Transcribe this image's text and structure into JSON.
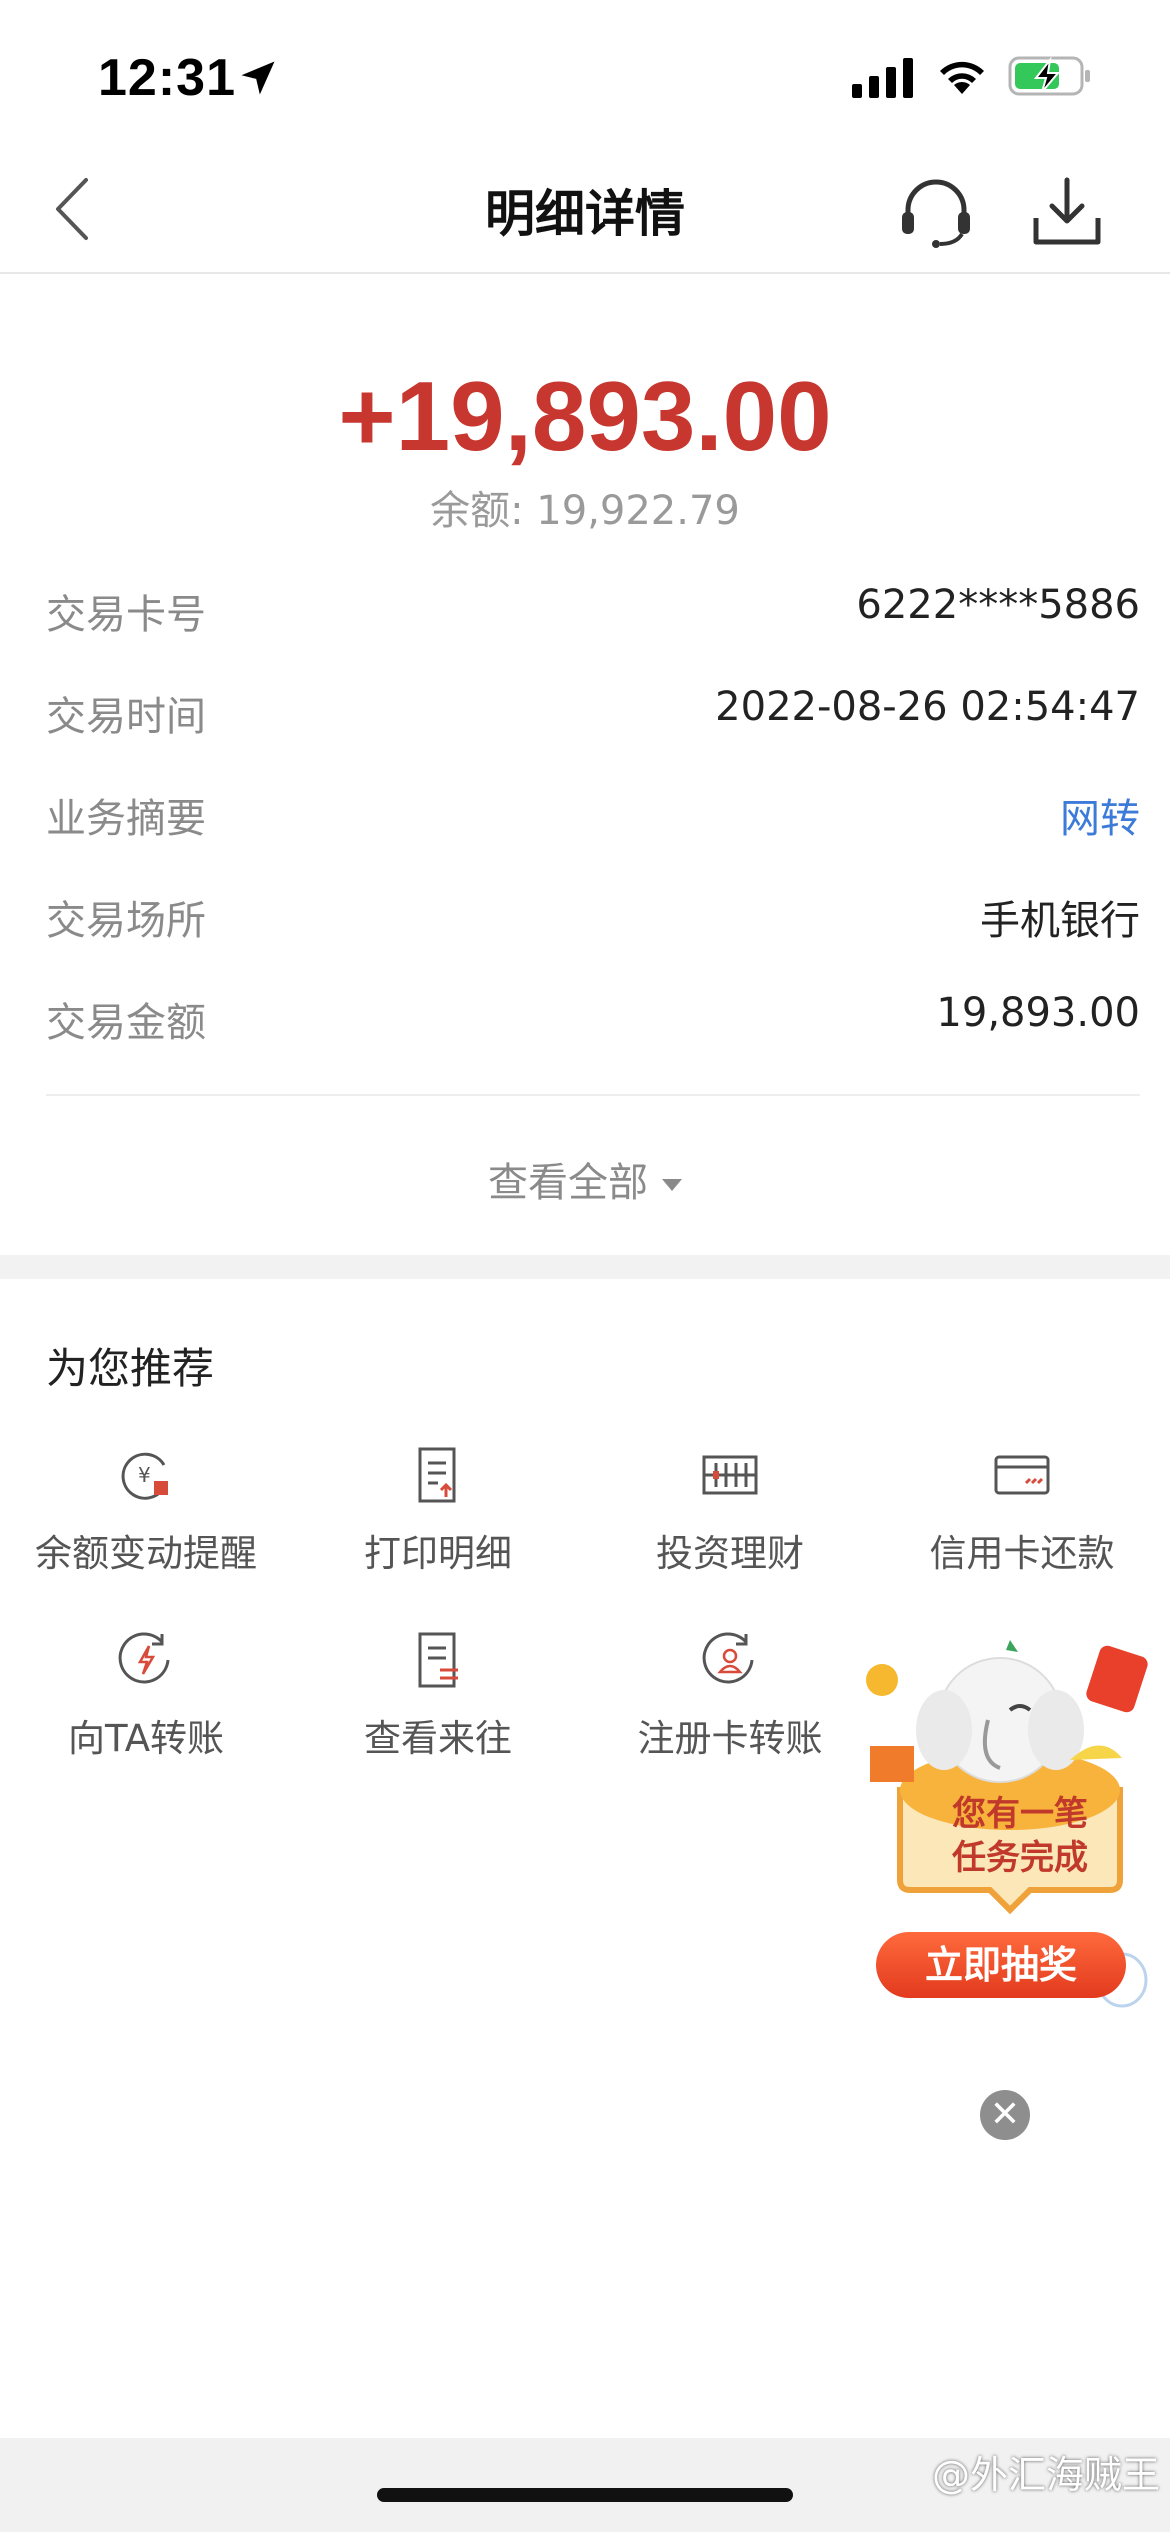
{
  "status": {
    "time": "12:31"
  },
  "nav": {
    "title": "明细详情"
  },
  "summary": {
    "amount": "+19,893.00",
    "balance": "余额: 19,922.79"
  },
  "details": [
    {
      "label": "交易卡号",
      "value": "6222****5886"
    },
    {
      "label": "交易时间",
      "value": "2022-08-26 02:54:47"
    },
    {
      "label": "业务摘要",
      "value": "网转"
    },
    {
      "label": "交易场所",
      "value": "手机银行"
    },
    {
      "label": "交易金额",
      "value": "19,893.00"
    }
  ],
  "view_all": "查看全部",
  "recommend": {
    "title": "为您推荐",
    "items": [
      {
        "label": "余额变动提醒",
        "icon": "yuan-bell-icon"
      },
      {
        "label": "打印明细",
        "icon": "print-doc-icon"
      },
      {
        "label": "投资理财",
        "icon": "abacus-icon"
      },
      {
        "label": "信用卡还款",
        "icon": "credit-card-icon"
      },
      {
        "label": "向TA转账",
        "icon": "lightning-circle-icon"
      },
      {
        "label": "查看来往",
        "icon": "doc-transfer-icon"
      },
      {
        "label": "注册卡转账",
        "icon": "user-circle-icon"
      }
    ]
  },
  "promo": {
    "line1": "您有一笔",
    "line2": "任务完成",
    "button": "立即抽奖"
  },
  "watermark": "@外汇海贼王",
  "colors": {
    "amount": "#c7372f",
    "link": "#3d7bd8",
    "accent": "#d84a3a"
  }
}
